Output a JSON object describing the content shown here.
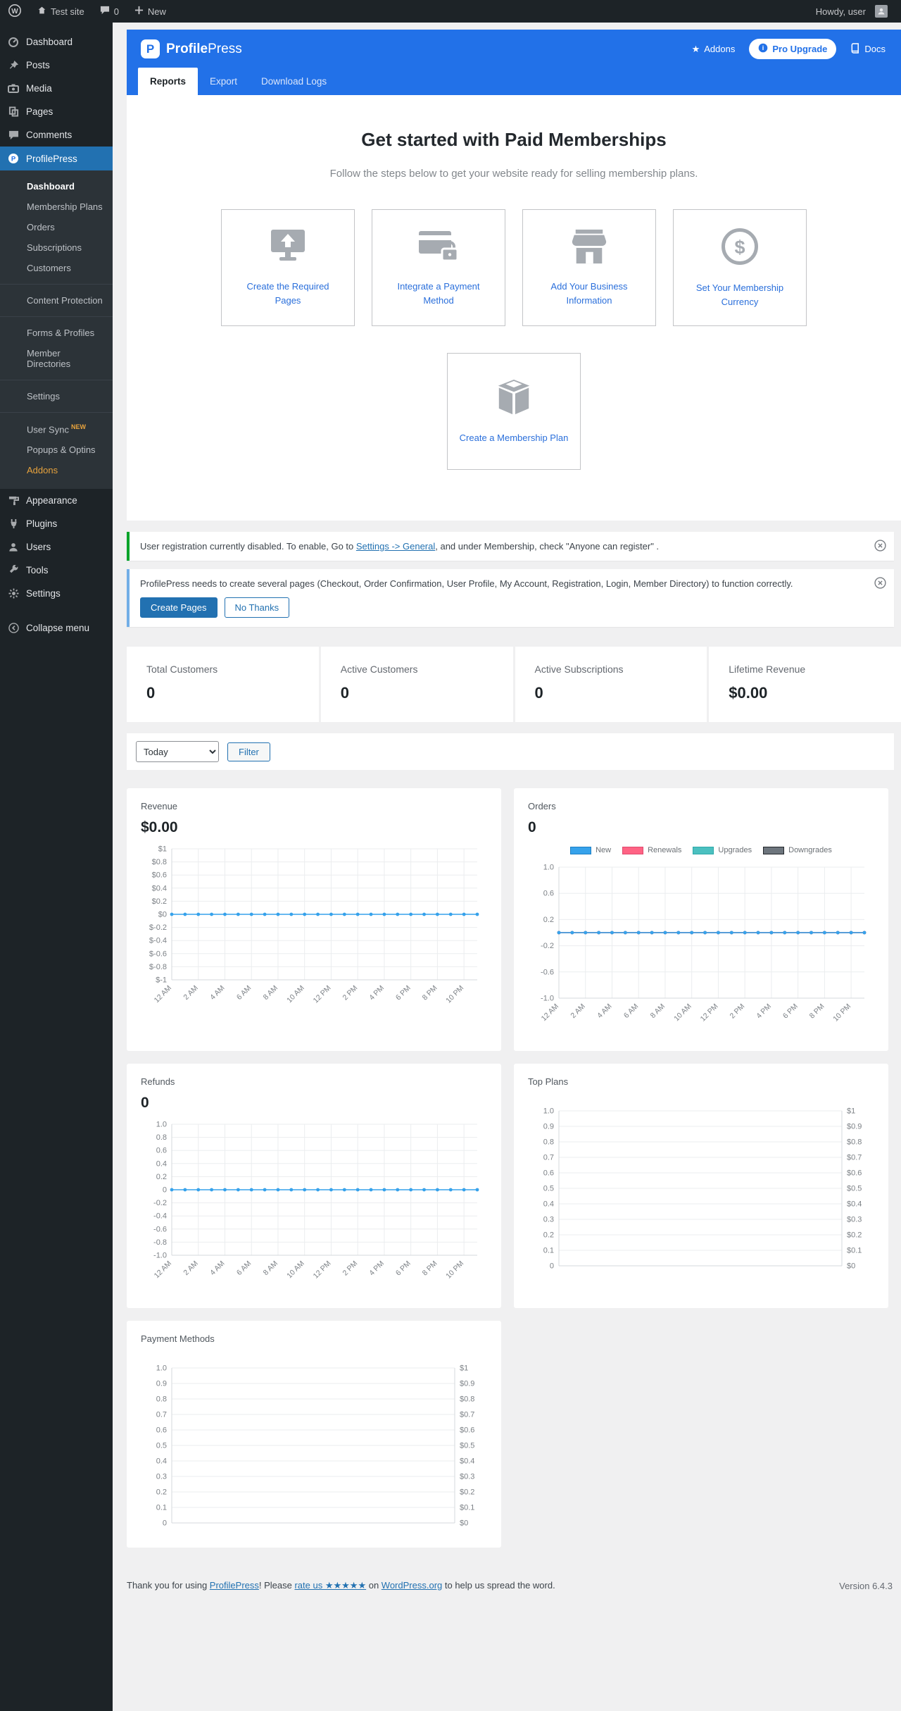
{
  "colors": {
    "brand_blue": "#2271e8",
    "wp_link_blue": "#2271b1",
    "menu_active_blue": "#2271b1",
    "notice_green": "#00a32a",
    "notice_blue": "#72aee6",
    "chart_line_blue": "#36a2eb",
    "grid": "#ebedef",
    "axis": "#d5d9dc",
    "tick_text": "#7c8186",
    "addons_orange": "#e8a33d"
  },
  "admin_bar": {
    "site": "Test site",
    "comments_count": "0",
    "new_label": "New",
    "howdy": "Howdy, user"
  },
  "sidebar": {
    "top": [
      {
        "label": "Dashboard"
      },
      {
        "label": "Posts"
      },
      {
        "label": "Media"
      },
      {
        "label": "Pages"
      },
      {
        "label": "Comments"
      }
    ],
    "current": {
      "label": "ProfilePress"
    },
    "submenu": [
      "Dashboard",
      "Membership Plans",
      "Orders",
      "Subscriptions",
      "Customers",
      "Content Protection",
      "Forms & Profiles",
      "Member Directories",
      "Settings",
      "User Sync",
      "Popups & Optins",
      "Addons"
    ],
    "usersync_badge": "NEW",
    "bottom": [
      {
        "label": "Appearance"
      },
      {
        "label": "Plugins"
      },
      {
        "label": "Users"
      },
      {
        "label": "Tools"
      },
      {
        "label": "Settings"
      },
      {
        "label": "Collapse menu"
      }
    ]
  },
  "header": {
    "brand_bold": "Profile",
    "brand_rest": "Press",
    "addons": "Addons",
    "pro_upgrade": "Pro Upgrade",
    "docs": "Docs"
  },
  "tabs": [
    {
      "label": "Reports",
      "active": true
    },
    {
      "label": "Export",
      "active": false
    },
    {
      "label": "Download Logs",
      "active": false
    }
  ],
  "hero": {
    "title": "Get started with Paid Memberships",
    "subtitle": "Follow the steps below to get your website ready for selling membership plans.",
    "cards": [
      {
        "label": "Create the Required Pages",
        "icon": "monitor-upload-icon"
      },
      {
        "label": "Integrate a Payment Method",
        "icon": "credit-card-lock-icon"
      },
      {
        "label": "Add Your Business Information",
        "icon": "storefront-icon"
      },
      {
        "label": "Set Your Membership Currency",
        "icon": "dollar-circle-icon"
      },
      {
        "label": "Create a Membership Plan",
        "icon": "package-box-icon"
      }
    ]
  },
  "notices": {
    "registration": {
      "before": "User registration currently disabled. To enable, Go to ",
      "link": "Settings -> General",
      "after": ", and under Membership, check \"Anyone can register\" ."
    },
    "pages": {
      "text": "ProfilePress needs to create several pages (Checkout, Order Confirmation, User Profile, My Account, Registration, Login, Member Directory) to function correctly.",
      "create_button": "Create Pages",
      "decline_button": "No Thanks"
    }
  },
  "stats": [
    {
      "label": "Total Customers",
      "value": "0"
    },
    {
      "label": "Active Customers",
      "value": "0"
    },
    {
      "label": "Active Subscriptions",
      "value": "0"
    },
    {
      "label": "Lifetime Revenue",
      "value": "$0.00"
    }
  ],
  "filter": {
    "selected": "Today",
    "button": "Filter"
  },
  "chart_data": [
    {
      "id": "revenue",
      "type": "line",
      "title": "Revenue",
      "value": "$0.00",
      "ylim": [
        -1,
        1
      ],
      "y_ticks": [
        "$1",
        "$0.8",
        "$0.6",
        "$0.4",
        "$0.2",
        "$0",
        "$-0.2",
        "$-0.4",
        "$-0.6",
        "$-0.8",
        "$-1"
      ],
      "x_tick_labels": [
        "12 AM",
        "2 AM",
        "4 AM",
        "6 AM",
        "8 AM",
        "10 AM",
        "12 PM",
        "2 PM",
        "4 PM",
        "6 PM",
        "8 PM",
        "10 PM"
      ],
      "num_points": 24,
      "series": [
        {
          "name": "Revenue",
          "color": "#36a2eb",
          "values": [
            0,
            0,
            0,
            0,
            0,
            0,
            0,
            0,
            0,
            0,
            0,
            0,
            0,
            0,
            0,
            0,
            0,
            0,
            0,
            0,
            0,
            0,
            0,
            0
          ]
        }
      ]
    },
    {
      "id": "orders",
      "type": "line",
      "title": "Orders",
      "value": "0",
      "ylim": [
        -1,
        1
      ],
      "y_ticks": [
        "1.0",
        "0.6",
        "0.2",
        "-0.2",
        "-0.6",
        "-1.0"
      ],
      "x_tick_labels": [
        "12 AM",
        "2 AM",
        "4 AM",
        "6 AM",
        "8 AM",
        "10 AM",
        "12 PM",
        "2 PM",
        "4 PM",
        "6 PM",
        "8 PM",
        "10 PM"
      ],
      "num_points": 24,
      "legend": [
        {
          "label": "New",
          "color": "#36a2eb",
          "border": "#1d7fc4"
        },
        {
          "label": "Renewals",
          "color": "#ff6384",
          "border": "#e04a6e"
        },
        {
          "label": "Upgrades",
          "color": "#4bc0c0",
          "border": "#2ea8a8"
        },
        {
          "label": "Downgrades",
          "color": "#6d757d",
          "border": "#23272b"
        }
      ],
      "series": [
        {
          "name": "New",
          "color": "#36a2eb",
          "values": [
            0,
            0,
            0,
            0,
            0,
            0,
            0,
            0,
            0,
            0,
            0,
            0,
            0,
            0,
            0,
            0,
            0,
            0,
            0,
            0,
            0,
            0,
            0,
            0
          ]
        },
        {
          "name": "Renewals",
          "color": "#ff6384",
          "values": [
            0,
            0,
            0,
            0,
            0,
            0,
            0,
            0,
            0,
            0,
            0,
            0,
            0,
            0,
            0,
            0,
            0,
            0,
            0,
            0,
            0,
            0,
            0,
            0
          ]
        },
        {
          "name": "Upgrades",
          "color": "#4bc0c0",
          "values": [
            0,
            0,
            0,
            0,
            0,
            0,
            0,
            0,
            0,
            0,
            0,
            0,
            0,
            0,
            0,
            0,
            0,
            0,
            0,
            0,
            0,
            0,
            0,
            0
          ]
        },
        {
          "name": "Downgrades",
          "color": "#6d757d",
          "values": [
            0,
            0,
            0,
            0,
            0,
            0,
            0,
            0,
            0,
            0,
            0,
            0,
            0,
            0,
            0,
            0,
            0,
            0,
            0,
            0,
            0,
            0,
            0,
            0
          ]
        }
      ]
    },
    {
      "id": "refunds",
      "type": "line",
      "title": "Refunds",
      "value": "0",
      "ylim": [
        -1,
        1
      ],
      "y_ticks": [
        "1.0",
        "0.8",
        "0.6",
        "0.4",
        "0.2",
        "0",
        "-0.2",
        "-0.4",
        "-0.6",
        "-0.8",
        "-1.0"
      ],
      "x_tick_labels": [
        "12 AM",
        "2 AM",
        "4 AM",
        "6 AM",
        "8 AM",
        "10 AM",
        "12 PM",
        "2 PM",
        "4 PM",
        "6 PM",
        "8 PM",
        "10 PM"
      ],
      "num_points": 24,
      "series": [
        {
          "name": "Refunds",
          "color": "#36a2eb",
          "values": [
            0,
            0,
            0,
            0,
            0,
            0,
            0,
            0,
            0,
            0,
            0,
            0,
            0,
            0,
            0,
            0,
            0,
            0,
            0,
            0,
            0,
            0,
            0,
            0
          ]
        }
      ]
    },
    {
      "id": "top-plans",
      "type": "line",
      "title": "Top Plans",
      "ylim": [
        0,
        1
      ],
      "y_ticks_left": [
        "1.0",
        "0.9",
        "0.8",
        "0.7",
        "0.6",
        "0.5",
        "0.4",
        "0.3",
        "0.2",
        "0.1",
        "0"
      ],
      "y_ticks_right": [
        "$1",
        "$0.9",
        "$0.8",
        "$0.7",
        "$0.6",
        "$0.5",
        "$0.4",
        "$0.3",
        "$0.2",
        "$0.1",
        "$0"
      ],
      "series": []
    },
    {
      "id": "payment-methods",
      "type": "line",
      "title": "Payment Methods",
      "ylim": [
        0,
        1
      ],
      "y_ticks_left": [
        "1.0",
        "0.9",
        "0.8",
        "0.7",
        "0.6",
        "0.5",
        "0.4",
        "0.3",
        "0.2",
        "0.1",
        "0"
      ],
      "y_ticks_right": [
        "$1",
        "$0.9",
        "$0.8",
        "$0.7",
        "$0.6",
        "$0.5",
        "$0.4",
        "$0.3",
        "$0.2",
        "$0.1",
        "$0"
      ],
      "series": []
    }
  ],
  "footer": {
    "pre": "Thank you for using ",
    "link_profilepress": "ProfilePress",
    "mid": "! Please ",
    "link_rate": "rate us ★★★★★",
    "mid2": " on ",
    "link_wp": "WordPress.org",
    "post": " to help us spread the word.",
    "version": "Version 6.4.3"
  }
}
